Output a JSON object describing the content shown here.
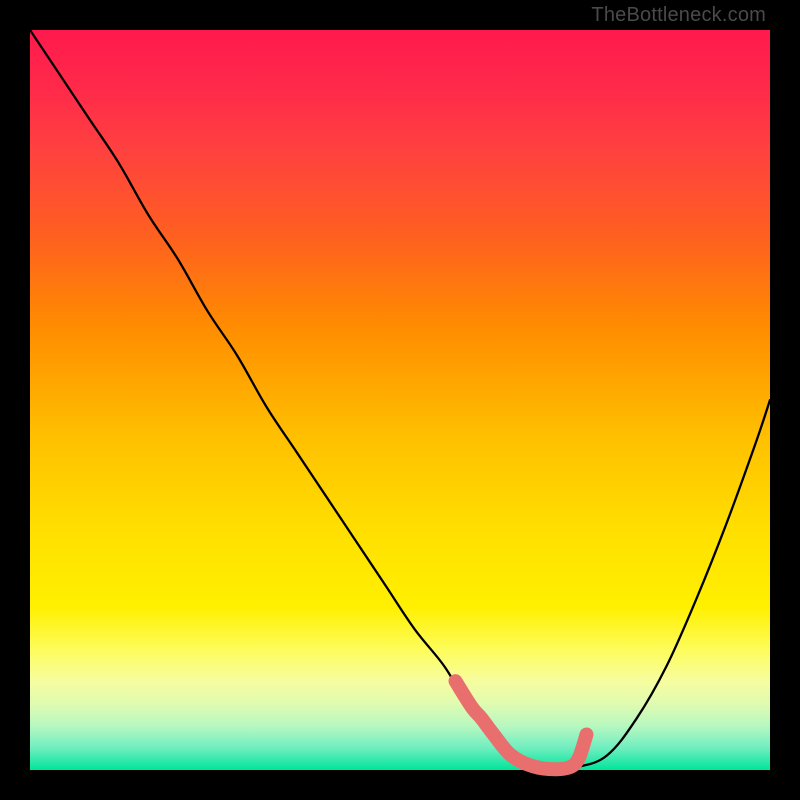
{
  "watermark": "TheBottleneck.com",
  "colors": {
    "curve": "#000000",
    "highlight": "#e96f6e",
    "background_top": "#ff1a4d",
    "background_bottom": "#00e59a",
    "frame": "#000000"
  },
  "chart_data": {
    "type": "line",
    "title": "",
    "xlabel": "",
    "ylabel": "",
    "xlim": [
      0,
      100
    ],
    "ylim": [
      0,
      100
    ],
    "grid": false,
    "series": [
      {
        "name": "bottleneck-curve",
        "x": [
          0,
          4,
          8,
          12,
          16,
          20,
          24,
          28,
          32,
          36,
          40,
          44,
          48,
          52,
          56,
          59,
          62,
          65,
          68,
          71,
          74,
          78,
          82,
          86,
          90,
          94,
          98,
          100
        ],
        "y": [
          100,
          94,
          88,
          82,
          75,
          69,
          62,
          56,
          49,
          43,
          37,
          31,
          25,
          19,
          14,
          9,
          5,
          2,
          0.5,
          0.1,
          0.4,
          2,
          7,
          14,
          23,
          33,
          44,
          50
        ]
      }
    ],
    "highlight_segment": {
      "name": "valley-highlight",
      "x": [
        57.5,
        59.7,
        61,
        62.5,
        65,
        68,
        71,
        73,
        74,
        74.6,
        75.2
      ],
      "y": [
        12,
        8.5,
        7,
        5,
        2,
        0.5,
        0.1,
        0.4,
        1.3,
        2.8,
        4.8
      ]
    }
  }
}
